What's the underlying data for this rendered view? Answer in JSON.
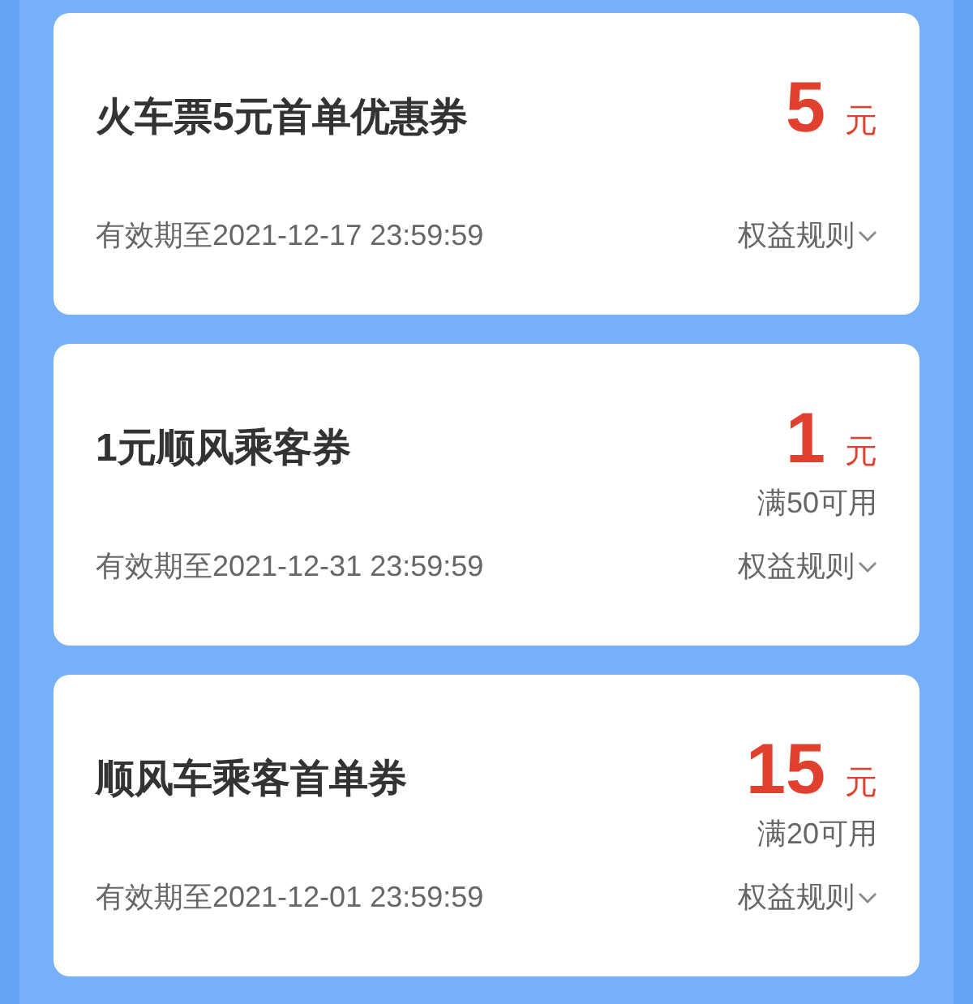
{
  "coupons": [
    {
      "title": "火车票5元首单优惠券",
      "amount": "5",
      "unit": "元",
      "validity": "有效期至2021-12-17 23:59:59",
      "rules_link": "权益规则"
    },
    {
      "title": "1元顺风乘客券",
      "amount": "1",
      "unit": "元",
      "condition": "满50可用",
      "validity": "有效期至2021-12-31 23:59:59",
      "rules_link": "权益规则"
    },
    {
      "title": "顺风车乘客首单券",
      "amount": "15",
      "unit": "元",
      "condition": "满20可用",
      "validity": "有效期至2021-12-01 23:59:59",
      "rules_link": "权益规则"
    }
  ]
}
